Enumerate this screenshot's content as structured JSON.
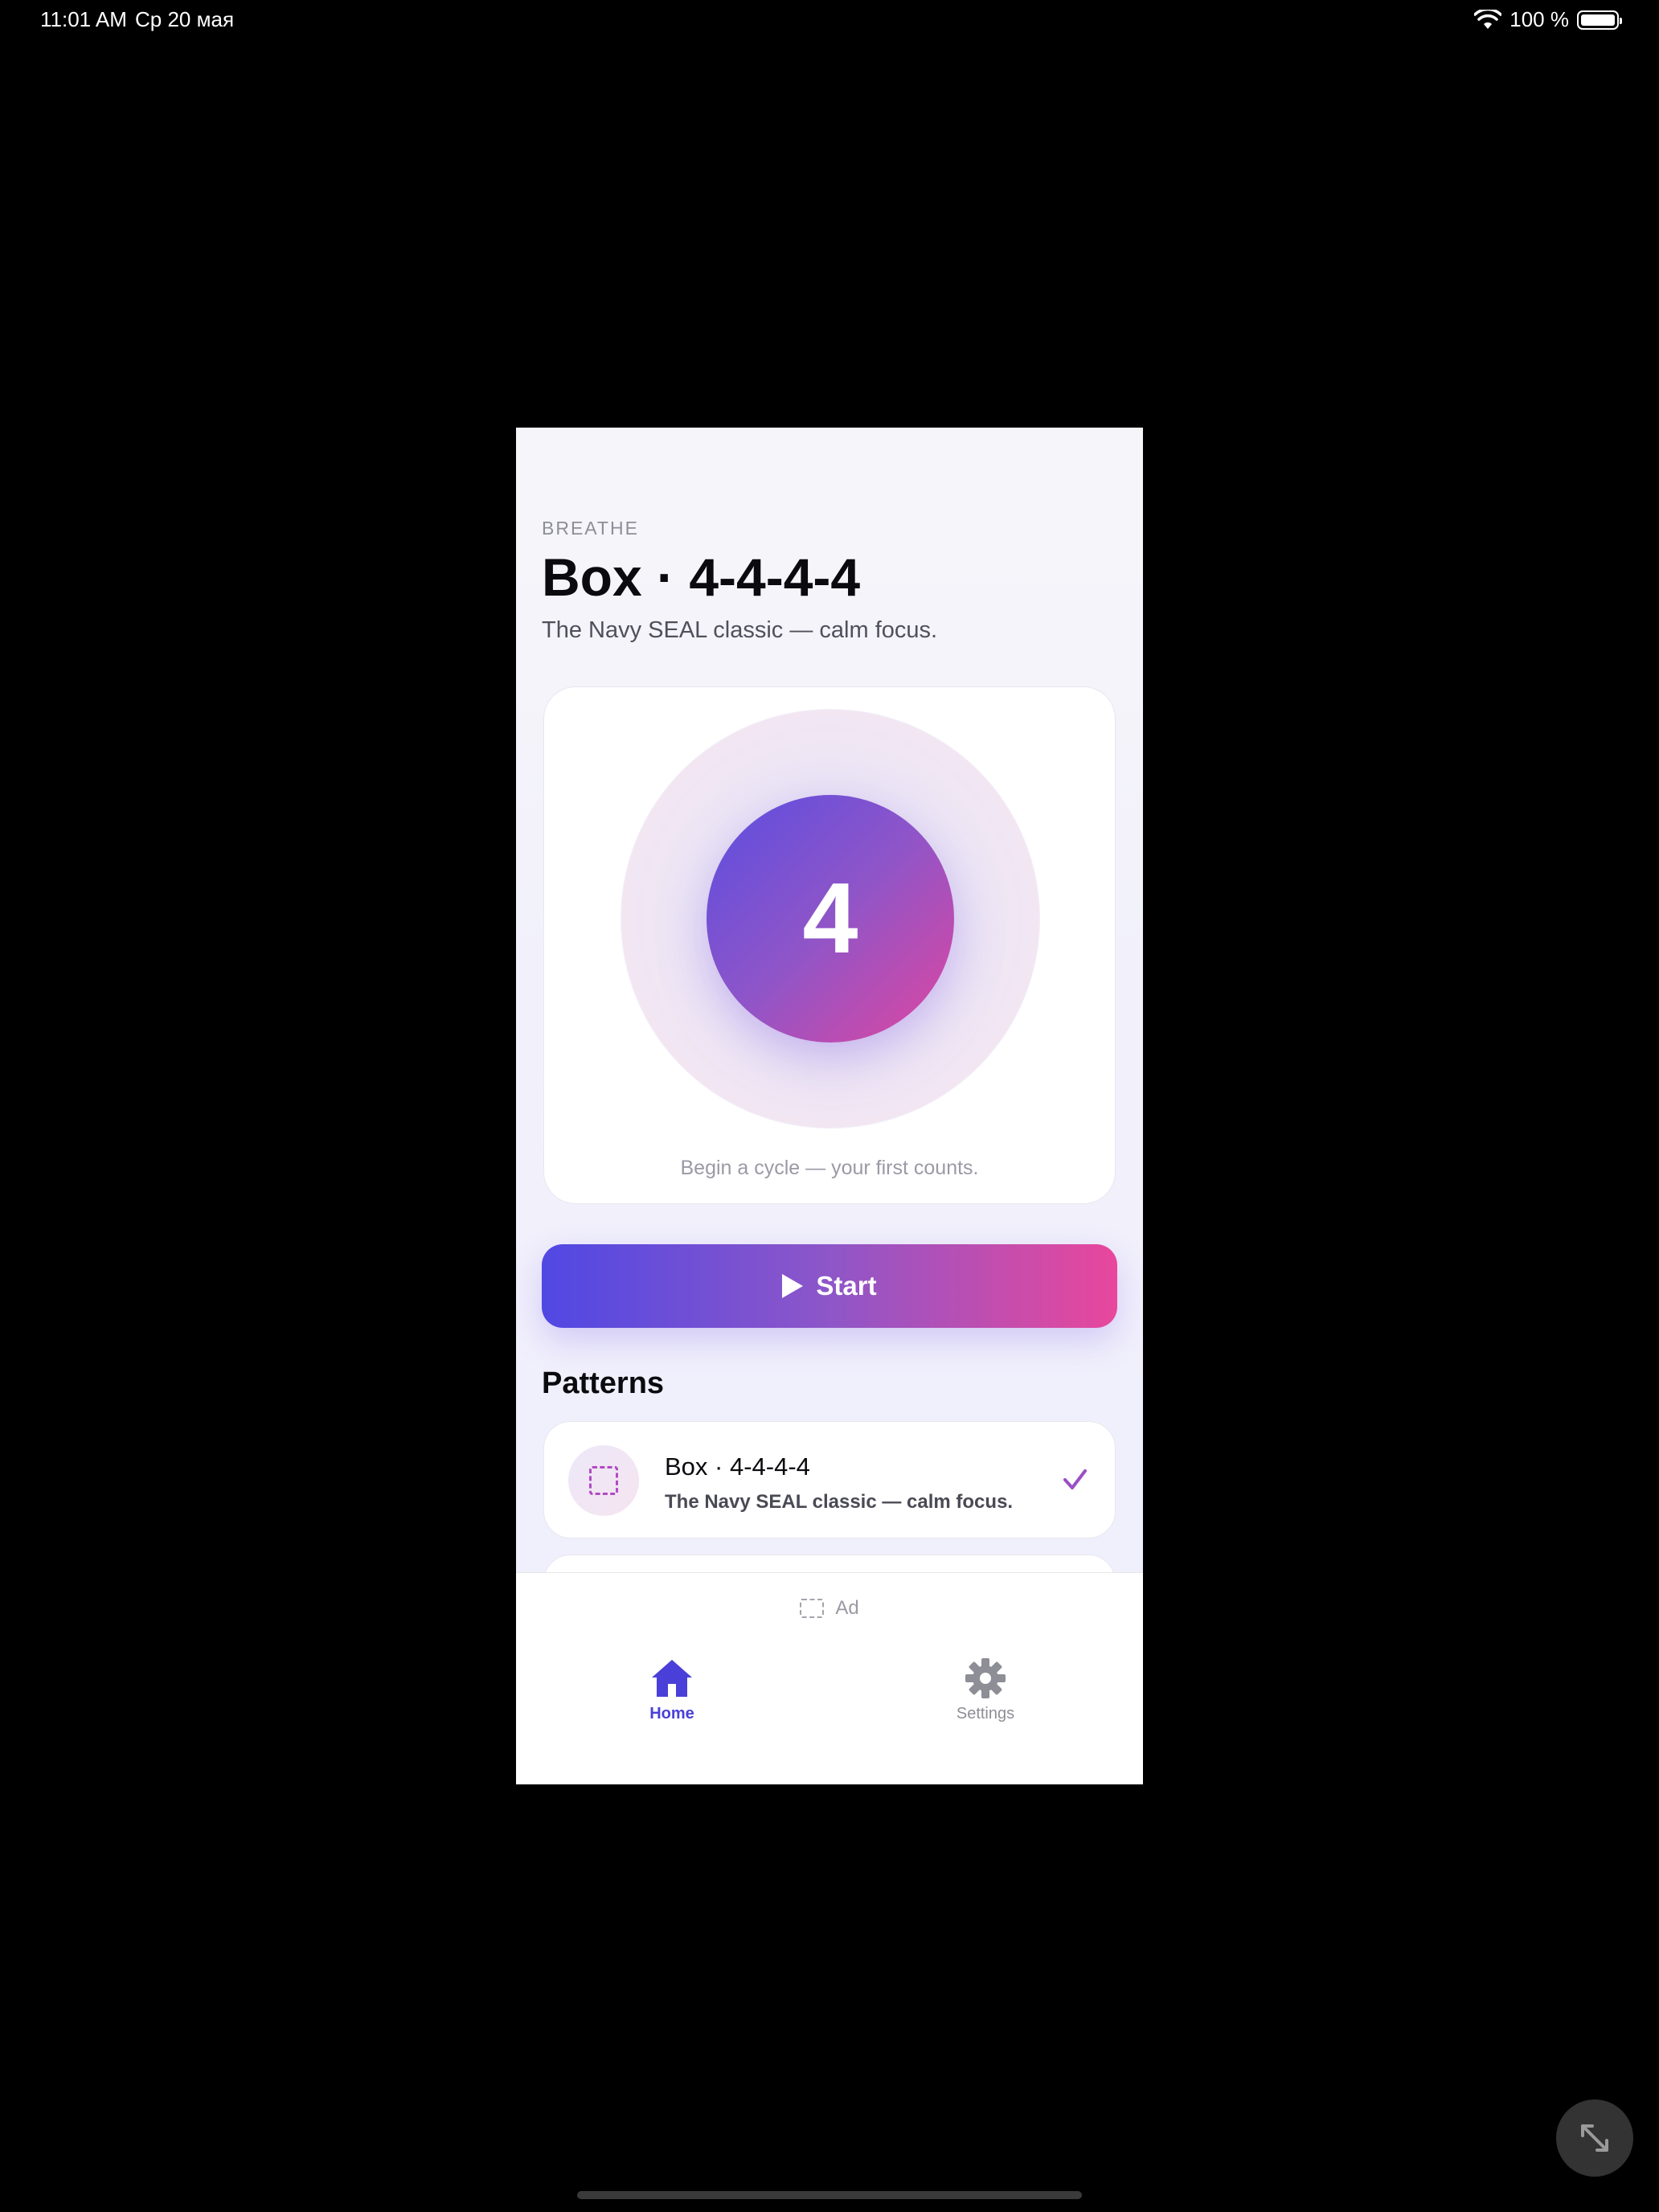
{
  "status_bar": {
    "time": "11:01 AM",
    "date": "Ср 20 мая",
    "battery": "100 %",
    "icons": [
      "wifi-icon",
      "battery-icon"
    ]
  },
  "header": {
    "eyebrow": "BREATHE",
    "title": "Box · 4-4-4-4",
    "subtitle": "The Navy SEAL classic — calm focus."
  },
  "breath_card": {
    "count": "4",
    "hint": "Begin a cycle — your first counts."
  },
  "start_button": {
    "label": "Start",
    "icon": "play-icon"
  },
  "patterns": {
    "heading": "Patterns",
    "items": [
      {
        "name": "Box · 4-4-4-4",
        "description": "The Navy SEAL classic — calm focus.",
        "icon": "dashed-square-icon",
        "selected": true
      }
    ]
  },
  "ad": {
    "label": "Ad",
    "icon": "ad-placeholder-icon"
  },
  "tab_bar": {
    "tabs": [
      {
        "label": "Home",
        "icon": "home-icon",
        "active": true
      },
      {
        "label": "Settings",
        "icon": "gear-icon",
        "active": false
      }
    ]
  },
  "colors": {
    "accent": "#4a3fd8",
    "gradient_start": "#5048e3",
    "gradient_end": "#e8479c",
    "check": "#9b4fc6"
  }
}
